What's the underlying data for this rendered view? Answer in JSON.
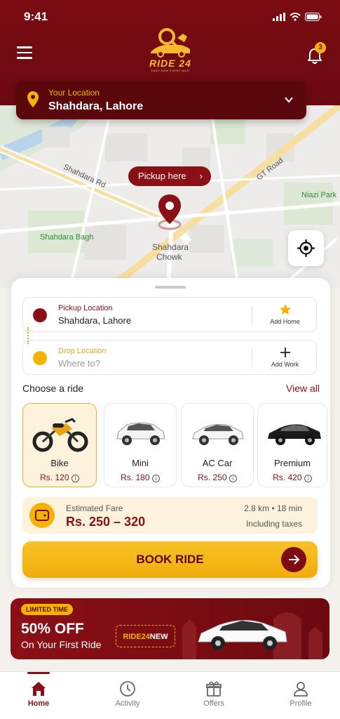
{
  "status_bar": {
    "time": "9:41"
  },
  "header": {
    "logo_text": "RIDE 24",
    "logo_tagline": "EASY RIDE EVERY MILE",
    "notification_count": "3"
  },
  "location_bar": {
    "label": "Your Location",
    "value": "Shahdara, Lahore"
  },
  "map": {
    "pickup_button": "Pickup here",
    "labels": {
      "shahdara_rd": "Shahdara Rd",
      "gt_road": "GT Road",
      "niazi_park": "Niazi Park",
      "shahdara_bagh": "Shahdara Bagh",
      "chowk_line1": "Shahdara",
      "chowk_line2": "Chowk"
    }
  },
  "booking": {
    "pickup": {
      "label": "Pickup Location",
      "value": "Shahdara, Lahore",
      "action": "Add Home"
    },
    "drop": {
      "label": "Drop Location",
      "placeholder": "Where to?",
      "action": "Add Work"
    },
    "choose_label": "Choose a ride",
    "view_all": "View all",
    "rides": [
      {
        "name": "Bike",
        "price": "Rs. 120",
        "selected": true
      },
      {
        "name": "Mini",
        "price": "Rs. 180",
        "selected": false
      },
      {
        "name": "AC Car",
        "price": "Rs. 250",
        "selected": false
      },
      {
        "name": "Premium",
        "price": "Rs. 420",
        "selected": false
      }
    ],
    "fare": {
      "label": "Estimated Fare",
      "value": "Rs.  250 – 320",
      "distance_time": "2.8 km  •  18 min",
      "note": "Including taxes"
    },
    "book_button": "BOOK RIDE"
  },
  "promo": {
    "tag": "LIMITED TIME",
    "headline": "50% OFF",
    "subline": "On Your First Ride",
    "code_prefix": "RIDE24",
    "code_suffix": "NEW"
  },
  "tabs": [
    {
      "label": "Home",
      "icon": "home-icon",
      "active": true
    },
    {
      "label": "Activity",
      "icon": "clock-icon",
      "active": false
    },
    {
      "label": "Offers",
      "icon": "gift-icon",
      "active": false
    },
    {
      "label": "Profile",
      "icon": "user-icon",
      "active": false
    }
  ],
  "colors": {
    "primary": "#7a0c12",
    "accent": "#f5b300",
    "map_bg": "#eeeceb"
  }
}
